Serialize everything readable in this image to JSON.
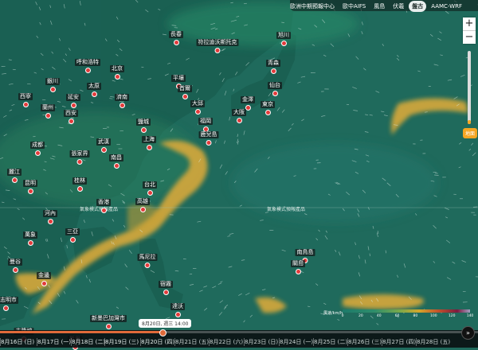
{
  "toolbar": {
    "items": [
      {
        "label": "歐洲中期預報中心",
        "active": false
      },
      {
        "label": "歐中AIFS",
        "active": false
      },
      {
        "label": "風島",
        "active": false
      },
      {
        "label": "伏羲",
        "active": false
      },
      {
        "label": "盤古",
        "active": true
      },
      {
        "label": "AAMC-WRF",
        "active": false
      }
    ]
  },
  "map_labels": {
    "left": "氣象模式預報產品",
    "right": "氣象模式預報產品"
  },
  "cities": [
    {
      "name": "長春"
    },
    {
      "name": "符拉迪沃斯托克"
    },
    {
      "name": "旭川"
    },
    {
      "name": "呼和浩特"
    },
    {
      "name": "北京"
    },
    {
      "name": "青森"
    },
    {
      "name": "銀川"
    },
    {
      "name": "太原"
    },
    {
      "name": "平壤"
    },
    {
      "name": "首爾"
    },
    {
      "name": "仙台"
    },
    {
      "name": "西寧"
    },
    {
      "name": "延安"
    },
    {
      "name": "濟南"
    },
    {
      "name": "大邱"
    },
    {
      "name": "金澤"
    },
    {
      "name": "蘭州"
    },
    {
      "name": "東京"
    },
    {
      "name": "大阪"
    },
    {
      "name": "西安"
    },
    {
      "name": "福岡"
    },
    {
      "name": "鹽城"
    },
    {
      "name": "鹿兒島"
    },
    {
      "name": "成都"
    },
    {
      "name": "武漢"
    },
    {
      "name": "上海"
    },
    {
      "name": "張家界"
    },
    {
      "name": "南昌"
    },
    {
      "name": "麗江"
    },
    {
      "name": "昆明"
    },
    {
      "name": "桂林"
    },
    {
      "name": "台北"
    },
    {
      "name": "香港"
    },
    {
      "name": "高雄"
    },
    {
      "name": "河內"
    },
    {
      "name": "萬象"
    },
    {
      "name": "三亞"
    },
    {
      "name": "南鳥島"
    },
    {
      "name": "關島"
    },
    {
      "name": "馬尼拉"
    },
    {
      "name": "曼谷"
    },
    {
      "name": "金邊"
    },
    {
      "name": "宿霧"
    },
    {
      "name": "胡志明市"
    },
    {
      "name": "達沃"
    },
    {
      "name": "新墨巴加灣市"
    },
    {
      "name": "吉隆坡"
    },
    {
      "name": "斯里"
    }
  ],
  "altitude": {
    "label": "地面",
    "level": 0.05
  },
  "legend": {
    "title": "風速/km/h",
    "ticks": [
      "0",
      "20",
      "40",
      "60",
      "80",
      "100",
      "120",
      "140"
    ]
  },
  "timeline": {
    "tooltip": "8月20日, 週三 14:00",
    "progress": 0.335,
    "days": [
      "8月16日 (日)",
      "8月17日 (一)",
      "8月18日 (二)",
      "8月19日 (三)",
      "8月20日 (四)",
      "8月21日 (五)",
      "8月22日 (六)",
      "8月23日 (日)",
      "8月24日 (一)",
      "8月25日 (二)",
      "8月26日 (三)",
      "8月27日 (四)",
      "8月28日 (五)"
    ]
  },
  "colors": {
    "ocean": "#1f6a5c",
    "jet": "#d8a93a",
    "accent": "#f5a623",
    "city_dot": "#e23b3b"
  }
}
